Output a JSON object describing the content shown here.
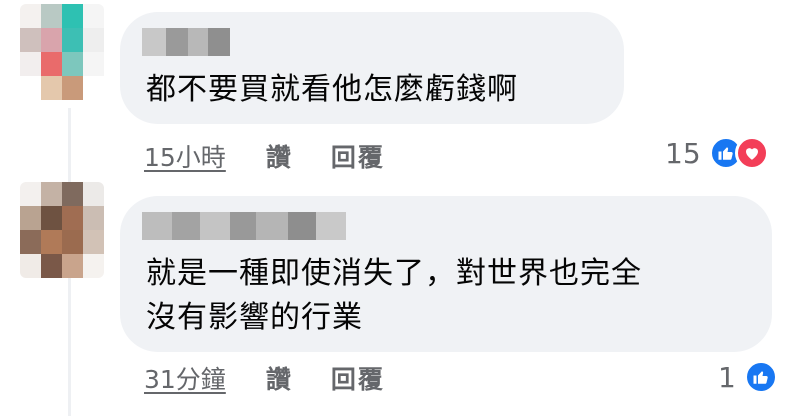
{
  "comments": [
    {
      "text_lines": [
        "都不要買就看他怎麼虧錢啊"
      ],
      "time": "15小時",
      "like_label": "讚",
      "reply_label": "回覆",
      "reaction_count": "15",
      "reactions": [
        "like-icon",
        "love-icon"
      ],
      "avatar_colors": [
        "#f4f1ef",
        "#b9c9c4",
        "#2ec1b2",
        "#f5f5f5",
        "#cfc0bd",
        "#d9a4ac",
        "#3dbfb4",
        "#eeeeee",
        "#f2eeee",
        "#e96b6b",
        "#7dc7bd",
        "#f5f5f5",
        "#ffffff",
        "#e4c8ac",
        "#c99a7a",
        "#ffffff"
      ]
    },
    {
      "text_lines": [
        "就是一種即使消失了，對世界也完全",
        "沒有影響的行業"
      ],
      "time": "31分鐘",
      "like_label": "讚",
      "reply_label": "回覆",
      "reaction_count": "1",
      "reactions": [
        "like-icon"
      ],
      "avatar_colors": [
        "#f3f0ee",
        "#c4b2a5",
        "#7f6a5e",
        "#eceae8",
        "#b9a391",
        "#6e5241",
        "#a06d52",
        "#cbbdb3",
        "#8b6b59",
        "#b07a58",
        "#9b6b4f",
        "#d2c2b6",
        "#f0ebe7",
        "#7a5848",
        "#c9a48c",
        "#f5f2ef"
      ]
    }
  ],
  "colors": {
    "bubble": "#f0f2f5",
    "meta_text": "#65676b",
    "like": "#1877f2",
    "love": "#f33e58"
  }
}
